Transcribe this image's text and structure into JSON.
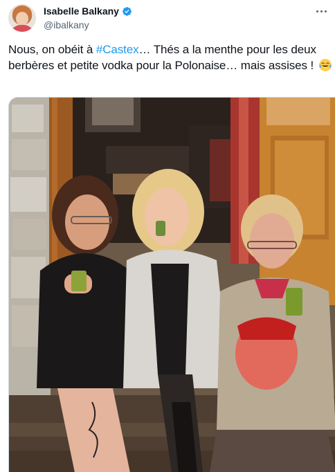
{
  "tweet": {
    "display_name": "Isabelle Balkany",
    "handle": "@ibalkany",
    "text_before_hashtag": "Nous, on obéit à ",
    "hashtag": "#Castex",
    "text_after_hashtag": "… Thés a la menthe pour les deux berbères et petite vodka pour la Polonaise… mais assises ! ",
    "emoji": "face-with-tears-of-joy"
  },
  "colors": {
    "link": "#1d9bf0",
    "verified": "#1d9bf0",
    "secondary_text": "#536471"
  },
  "icons": {
    "verified": "verified-badge-icon",
    "more": "more-options-icon"
  }
}
